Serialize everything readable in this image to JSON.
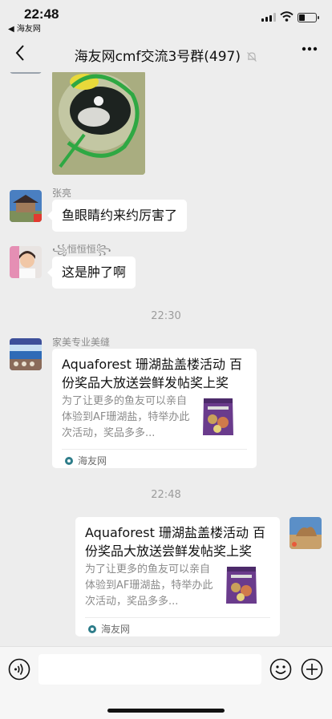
{
  "status_bar": {
    "time": "22:48",
    "back_app": "◀ 海友网",
    "battery_level": 0.35
  },
  "nav": {
    "title": "海友网cmf交流3号群(497)",
    "muted": true
  },
  "messages": {
    "m1": {
      "sender": "张亮",
      "text": "鱼眼睛约来约厉害了"
    },
    "m2": {
      "sender": "꧁恒恒恒꧂",
      "text": "这是肿了啊"
    },
    "time1": "22:30",
    "m3": {
      "sender": "家美专业美缝",
      "title": "Aquaforest 珊湖盐盖楼活动 百份奖品大放送尝鲜发帖奖上奖",
      "desc": "为了让更多的鱼友可以亲自体验到AF珊湖盐，特举办此次活动，奖品多多...",
      "source": "海友网"
    },
    "time2": "22:48",
    "m4": {
      "title": "Aquaforest 珊湖盐盖楼活动 百份奖品大放送尝鲜发帖奖上奖",
      "desc": "为了让更多的鱼友可以亲自体验到AF珊湖盐，特举办此次活动，奖品多多...",
      "source": "海友网"
    }
  },
  "input": {
    "placeholder": ""
  },
  "colors": {
    "background": "#ededed",
    "bubble": "#ffffff",
    "timestamp": "#9c9c9c"
  }
}
